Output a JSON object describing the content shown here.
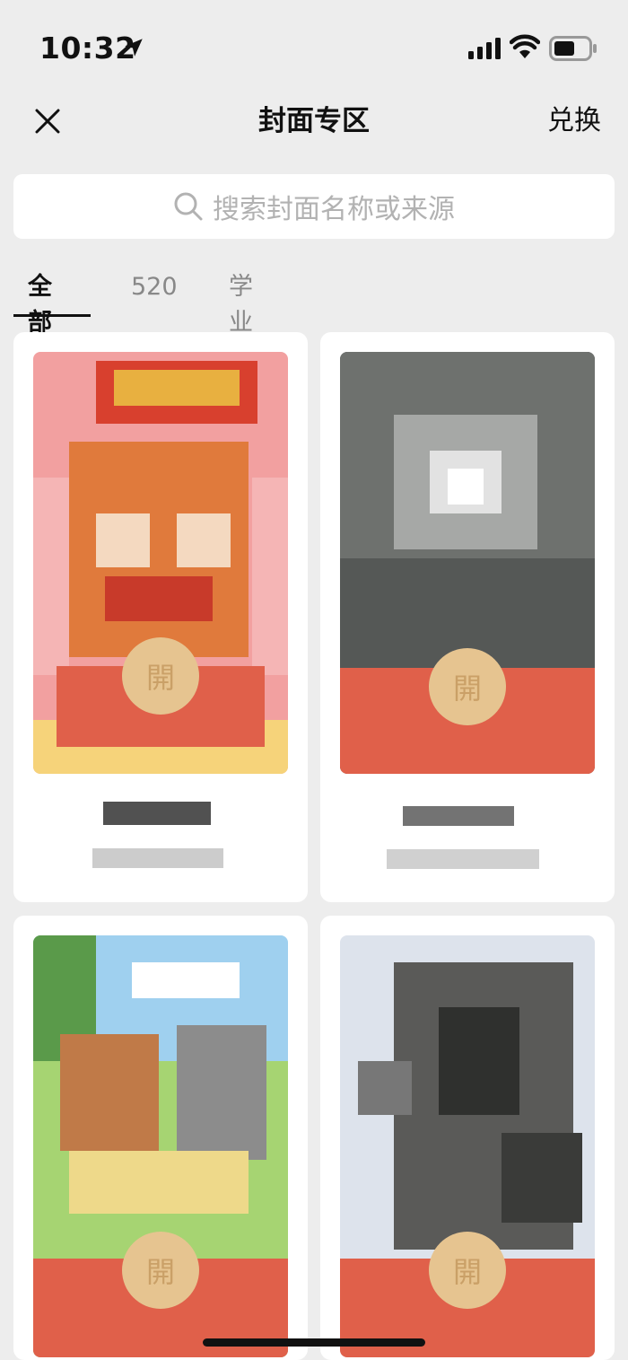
{
  "status_bar": {
    "time": "10:32"
  },
  "nav": {
    "close_icon": "close-icon",
    "title": "封面专区",
    "exchange_label": "兑换"
  },
  "search": {
    "icon": "search-icon",
    "placeholder": "搜索封面名称或来源"
  },
  "tabs": [
    {
      "label": "全部",
      "active": true
    },
    {
      "label": "520",
      "active": false
    },
    {
      "label": "学业",
      "active": false
    }
  ],
  "cards": [
    {
      "seal": "開",
      "name": "",
      "source": "",
      "theme": "cartoon-couple"
    },
    {
      "seal": "開",
      "name": "",
      "source": "",
      "theme": "sunlight-trees"
    },
    {
      "seal": "開",
      "name": "",
      "source": "",
      "theme": "cartoon-picnic"
    },
    {
      "seal": "開",
      "name": "",
      "source": "",
      "theme": "tree-branches"
    }
  ],
  "colors": {
    "background": "#ededed",
    "envelope_red": "#e0604a",
    "seal_gold": "#e6c490",
    "placeholder": "#b2b2b2"
  }
}
